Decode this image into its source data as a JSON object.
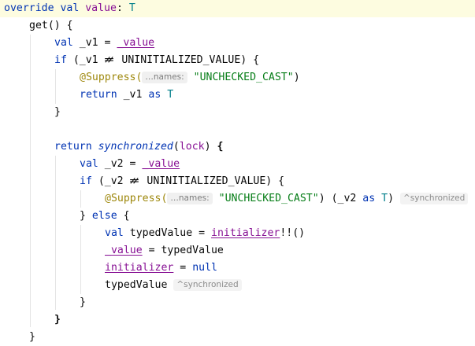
{
  "editor": {
    "type_param": "T",
    "lines": {
      "l1": {
        "kw": "override val",
        "name": "value",
        "colon": ":"
      },
      "l2": {
        "text": "get() {"
      },
      "l3": {
        "kw": "val",
        "pre": "_v1 =",
        "prop": "_value"
      },
      "l4": {
        "kw": "if",
        "pre": "(_v1",
        "op": "≠≠",
        "rest": "UNINITIALIZED_VALUE) {"
      },
      "l5": {
        "ann": "@Suppress(",
        "hint": "…names:",
        "str": "\"UNCHECKED_CAST\"",
        "close": ")"
      },
      "l6": {
        "kw": "return",
        "mid": "_v1",
        "kw2": "as"
      },
      "l7": {
        "text": "}"
      },
      "l8": {
        "kw": "return",
        "fn": "synchronized",
        "open": "(",
        "param": "lock",
        "close": ")",
        "brace": "{"
      },
      "l9": {
        "kw": "val",
        "pre": "_v2 =",
        "prop": "_value"
      },
      "l10": {
        "kw": "if",
        "pre": "(_v2",
        "op": "≠≠",
        "rest": "UNINITIALIZED_VALUE) {"
      },
      "l11": {
        "ann": "@Suppress(",
        "hint": "…names:",
        "str": "\"UNCHECKED_CAST\"",
        "mid": ") (_v2",
        "kw": "as",
        "close": ")",
        "chip": "^synchronized"
      },
      "l12": {
        "pre": "}",
        "kw": "else",
        "post": "{"
      },
      "l13": {
        "kw": "val",
        "pre": "typedValue =",
        "prop": "initializer",
        "post": "!!()"
      },
      "l14": {
        "prop": "_value",
        "post": "= typedValue"
      },
      "l15": {
        "prop": "initializer",
        "mid": "=",
        "kw": "null"
      },
      "l16": {
        "text": "typedValue",
        "chip": "^synchronized"
      },
      "l17": {
        "text": "}"
      },
      "l18": {
        "text": "}"
      },
      "l19": {
        "text": "}"
      }
    }
  }
}
